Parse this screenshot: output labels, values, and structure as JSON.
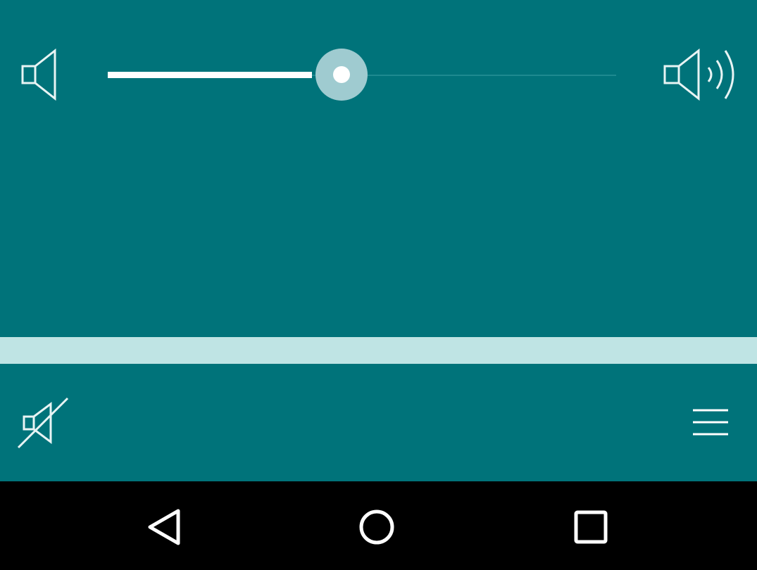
{
  "colors": {
    "background": "#00737a",
    "slider_fill": "#ffffff",
    "slider_thumb": "#9fcbd0",
    "slider_track": "#1e8a90",
    "divider_band": "#bfe4e4",
    "nav_bar": "#000000",
    "icon_stroke": "#e8f4f4"
  },
  "volume_slider": {
    "value": 0.46,
    "min_icon": "speaker-low-icon",
    "max_icon": "speaker-high-icon"
  },
  "bottom_bar": {
    "mute_icon": "speaker-mute-icon",
    "menu_icon": "hamburger-menu-icon"
  },
  "nav_bar": {
    "buttons": [
      "back-icon",
      "home-icon",
      "recents-icon"
    ]
  }
}
